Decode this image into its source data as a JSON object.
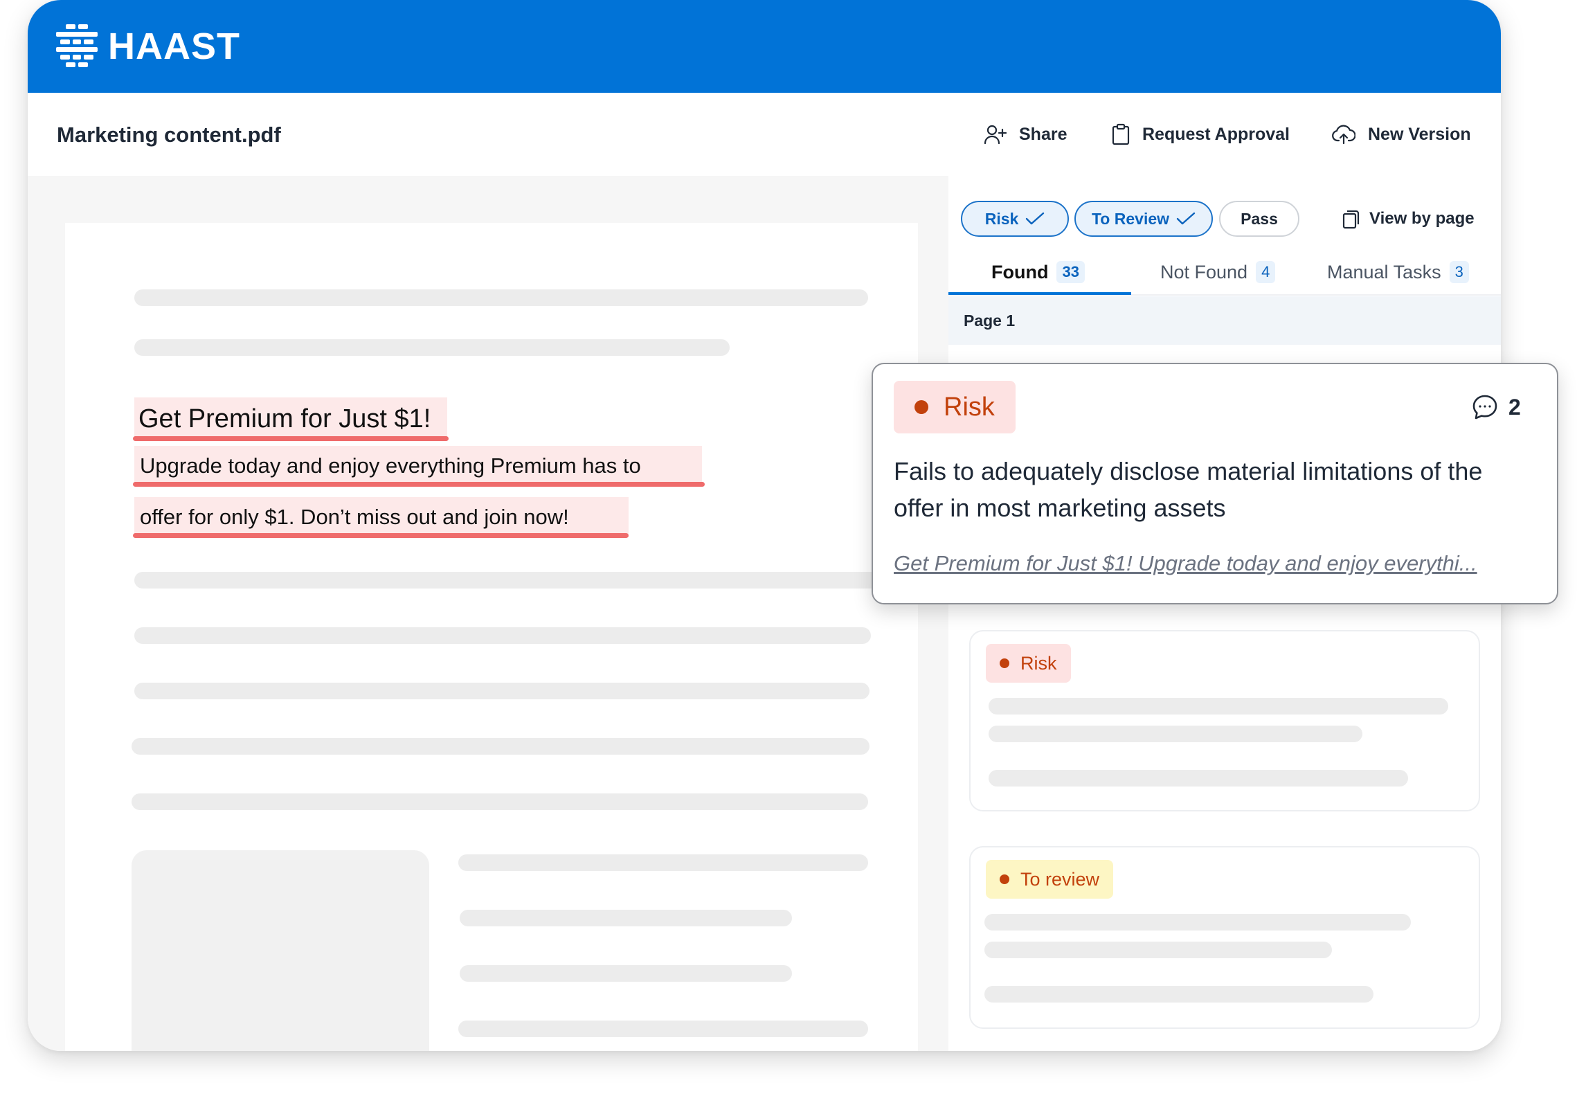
{
  "app": {
    "brand": "HAAST"
  },
  "file": {
    "name": "Marketing content.pdf"
  },
  "actions": {
    "share": "Share",
    "request_approval": "Request Approval",
    "new_version": "New Version"
  },
  "document": {
    "headline": "Get Premium for Just $1!",
    "line1": "Upgrade today and enjoy everything Premium has to",
    "line2": "offer for only $1. Don’t miss out and join now!"
  },
  "filters": {
    "risk": "Risk",
    "to_review": "To Review",
    "pass": "Pass",
    "view_by_page": "View by page"
  },
  "tabs": [
    {
      "label": "Found",
      "count": "33",
      "active": true
    },
    {
      "label": "Not Found",
      "count": "4"
    },
    {
      "label": "Manual Tasks",
      "count": "3"
    }
  ],
  "page_header": "Page 1",
  "popup": {
    "badge": "Risk",
    "comment_count": "2",
    "title": "Fails to adequately disclose material limitations of the offer in most marketing assets",
    "excerpt": "Get Premium for Just $1! Upgrade today and enjoy everythi..."
  },
  "cards": [
    {
      "badge": "Risk"
    },
    {
      "badge": "To review"
    }
  ],
  "colors": {
    "brand_blue": "#0173d7",
    "risk_text": "#c2410c",
    "risk_bg": "#fde2e2",
    "review_bg": "#fdf6c4",
    "highlight_underline": "#ef6b6b"
  }
}
